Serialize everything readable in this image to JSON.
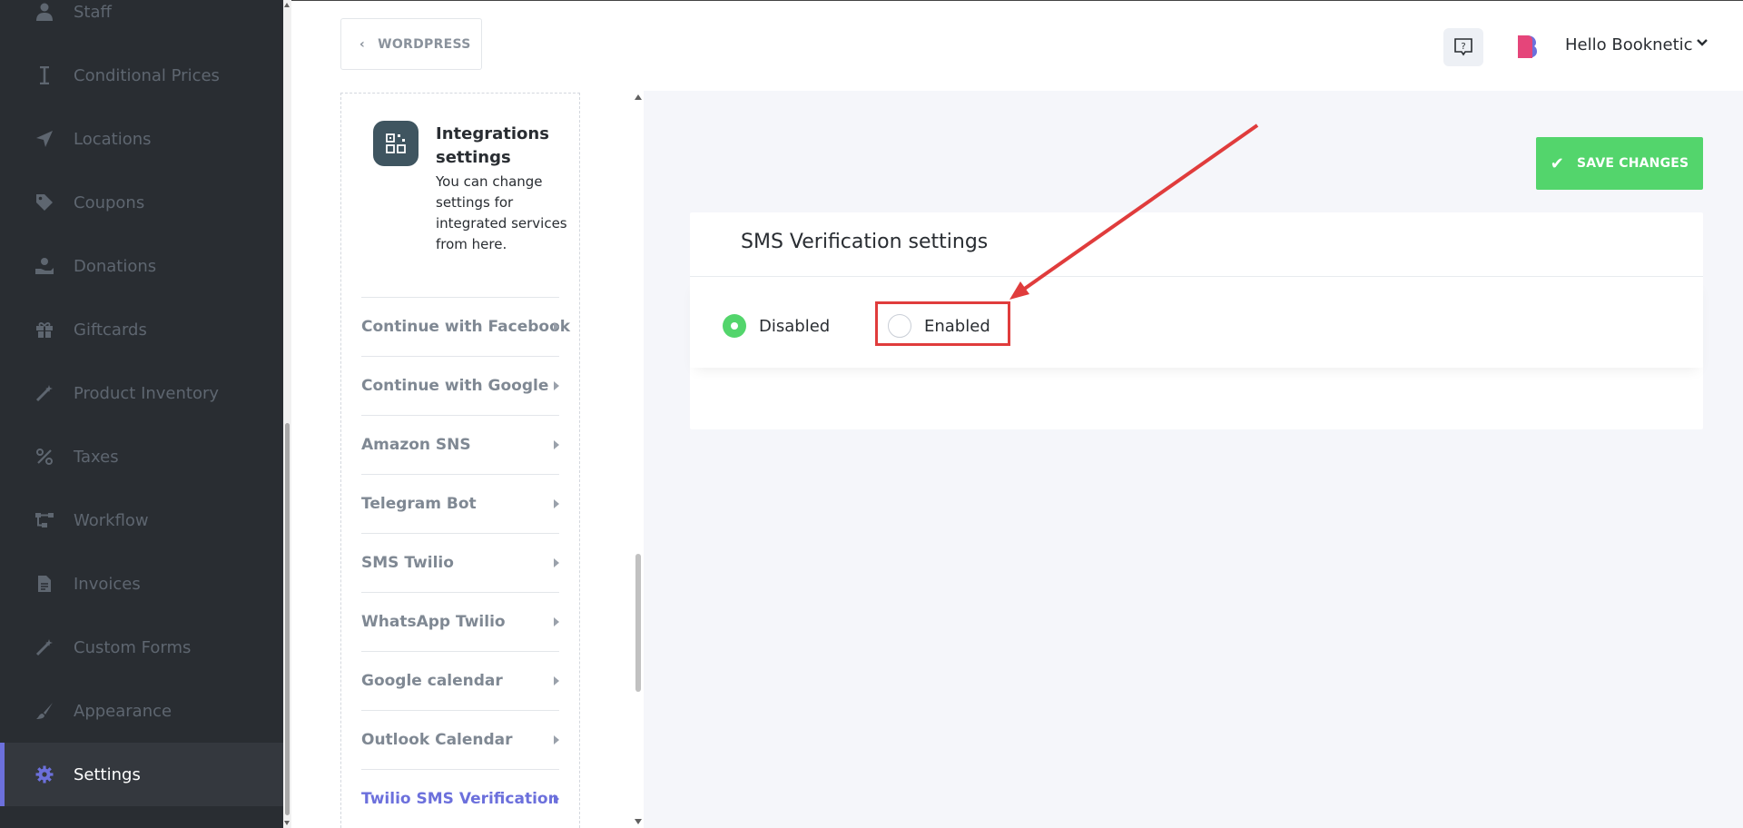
{
  "sidebar": {
    "items": [
      {
        "label": "Staff",
        "icon": "user-icon"
      },
      {
        "label": "Conditional Prices",
        "icon": "cursor-icon"
      },
      {
        "label": "Locations",
        "icon": "location-arrow-icon"
      },
      {
        "label": "Coupons",
        "icon": "tag-icon"
      },
      {
        "label": "Donations",
        "icon": "hand-holding-icon"
      },
      {
        "label": "Giftcards",
        "icon": "gift-icon"
      },
      {
        "label": "Product Inventory",
        "icon": "magic-wand-icon"
      },
      {
        "label": "Taxes",
        "icon": "percent-icon"
      },
      {
        "label": "Workflow",
        "icon": "workflow-icon"
      },
      {
        "label": "Invoices",
        "icon": "invoice-icon"
      },
      {
        "label": "Custom Forms",
        "icon": "magic-wand-icon"
      },
      {
        "label": "Appearance",
        "icon": "paint-brush-icon"
      },
      {
        "label": "Settings",
        "icon": "gear-icon",
        "active": true
      }
    ]
  },
  "header": {
    "wordpress_label": "WORDPRESS",
    "greeting": "Hello Booknetic"
  },
  "settings_nav": {
    "title": "Integrations settings",
    "description": "You can change settings for integrated services from here.",
    "items": [
      {
        "label": "Continue with Facebook"
      },
      {
        "label": "Continue with Google"
      },
      {
        "label": "Amazon SNS"
      },
      {
        "label": "Telegram Bot"
      },
      {
        "label": "SMS Twilio"
      },
      {
        "label": "WhatsApp Twilio"
      },
      {
        "label": "Google calendar"
      },
      {
        "label": "Outlook Calendar"
      },
      {
        "label": "Twilio SMS Verification",
        "active": true
      }
    ]
  },
  "main": {
    "save_label": "SAVE CHANGES",
    "panel_title": "SMS Verification settings",
    "options": [
      {
        "label": "Disabled",
        "selected": true
      },
      {
        "label": "Enabled",
        "selected": false
      }
    ]
  },
  "colors": {
    "accent": "#6c70dc",
    "success": "#53d56c",
    "annotation": "#e03c3c",
    "sidebar_bg": "#292d32"
  }
}
